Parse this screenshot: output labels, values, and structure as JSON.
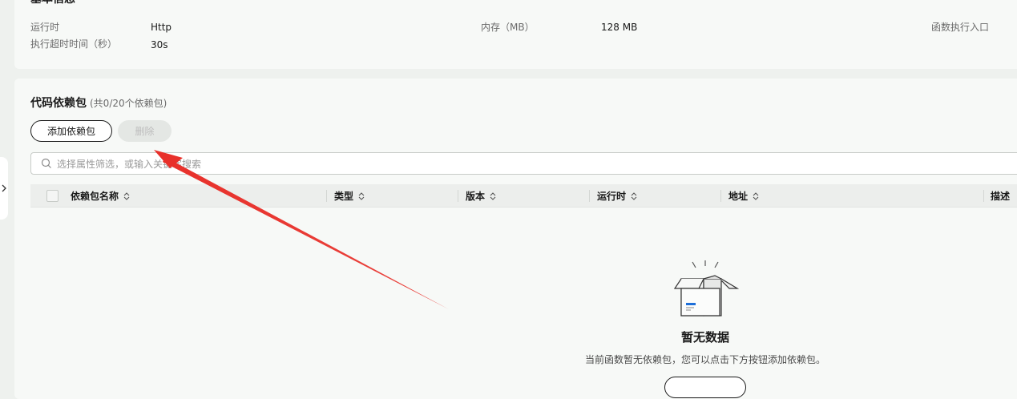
{
  "basic_info": {
    "title": "基本信息",
    "runtime_label": "运行时",
    "runtime_value": "Http",
    "timeout_label": "执行超时时间（秒）",
    "timeout_value": "30s",
    "memory_label": "内存（MB）",
    "memory_value": "128 MB",
    "entry_label": "函数执行入口"
  },
  "dependencies": {
    "title": "代码依赖包",
    "count_text": "(共0/20个依赖包)",
    "add_button": "添加依赖包",
    "delete_button": "删除",
    "search_placeholder": "选择属性筛选，或输入关键字搜索",
    "columns": [
      "依赖包名称",
      "类型",
      "版本",
      "运行时",
      "地址",
      "描述"
    ],
    "empty_title": "暂无数据",
    "empty_desc": "当前函数暂无依赖包，您可以点击下方按钮添加依赖包。"
  },
  "colors": {
    "annotation_arrow": "#e8302a",
    "accent_blue": "#1e6fd9"
  },
  "icons": [
    "search-icon",
    "sort-icon",
    "chevron-right-icon",
    "empty-box-icon"
  ]
}
